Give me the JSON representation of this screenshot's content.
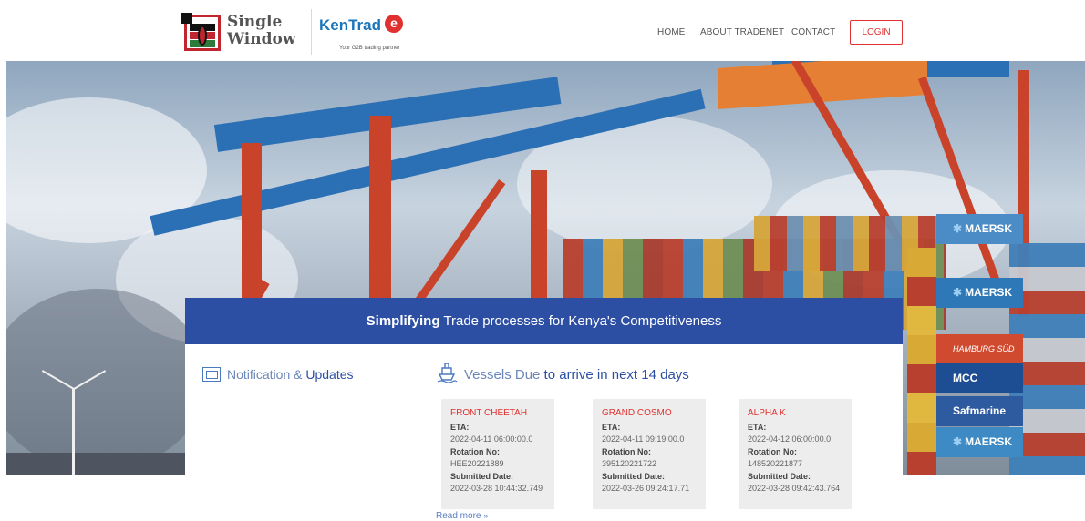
{
  "header": {
    "single_window": {
      "line1": "Single",
      "line2": "Window"
    },
    "kentrade": {
      "name": "KenTrad",
      "name_e": "e",
      "tagline": "Your G2B trading partner"
    },
    "nav": [
      {
        "label": "HOME"
      },
      {
        "label": "ABOUT TRADENET"
      },
      {
        "label": "CONTACT"
      }
    ],
    "login_label": "LOGIN"
  },
  "hero": {
    "containers": [
      "MAERSK",
      "MAERSK",
      "HAMBURG SÜD",
      "MCC",
      "Safmarine",
      "MAERSK"
    ]
  },
  "panel": {
    "headline_bold": "Simplifying",
    "headline_rest": " Trade processes for Kenya's Competitiveness",
    "notifications": {
      "title_plain": "Notification & ",
      "title_hl": "Updates"
    },
    "vessels": {
      "title_plain": "Vessels Due ",
      "title_hl": "to arrive in next 14 days",
      "labels": {
        "eta": "ETA:",
        "rotation": "Rotation No:",
        "submitted": "Submitted Date:"
      },
      "cards": [
        {
          "name": "FRONT CHEETAH",
          "eta": "2022-04-11 06:00:00.0",
          "rotation": "HEE20221889",
          "submitted": "2022-03-28 10:44:32.749"
        },
        {
          "name": "GRAND COSMO",
          "eta": "2022-04-11 09:19:00.0",
          "rotation": "395120221722",
          "submitted": "2022-03-26 09:24:17.71"
        },
        {
          "name": "ALPHA K",
          "eta": "2022-04-12 06:00:00.0",
          "rotation": "148520221877",
          "submitted": "2022-03-28 09:42:43.764"
        }
      ],
      "read_more": "Read more",
      "read_more_arrow": "»"
    }
  },
  "colors": {
    "brand_blue": "#2c4fa3",
    "accent_red": "#e0312f",
    "card_bg": "#ededed"
  }
}
